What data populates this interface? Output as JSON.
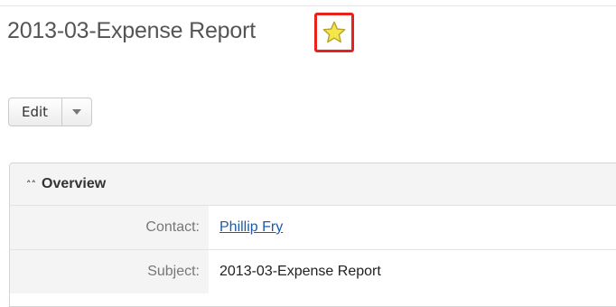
{
  "record": {
    "title": "2013-03-Expense Report",
    "favorite_icon": "star-icon"
  },
  "actions": {
    "edit_label": "Edit",
    "dropdown_icon": "caret-down-icon"
  },
  "panel": {
    "header": "Overview",
    "header_icon": "chevron-double-up-icon",
    "fields": [
      {
        "label": "Contact:",
        "value": "Phillip Fry",
        "is_link": true
      },
      {
        "label": "Subject:",
        "value": "2013-03-Expense Report",
        "is_link": false
      }
    ]
  },
  "colors": {
    "highlight_border": "#e8211a",
    "star_fill": "#f5e64a",
    "link": "#1e5aa8"
  }
}
